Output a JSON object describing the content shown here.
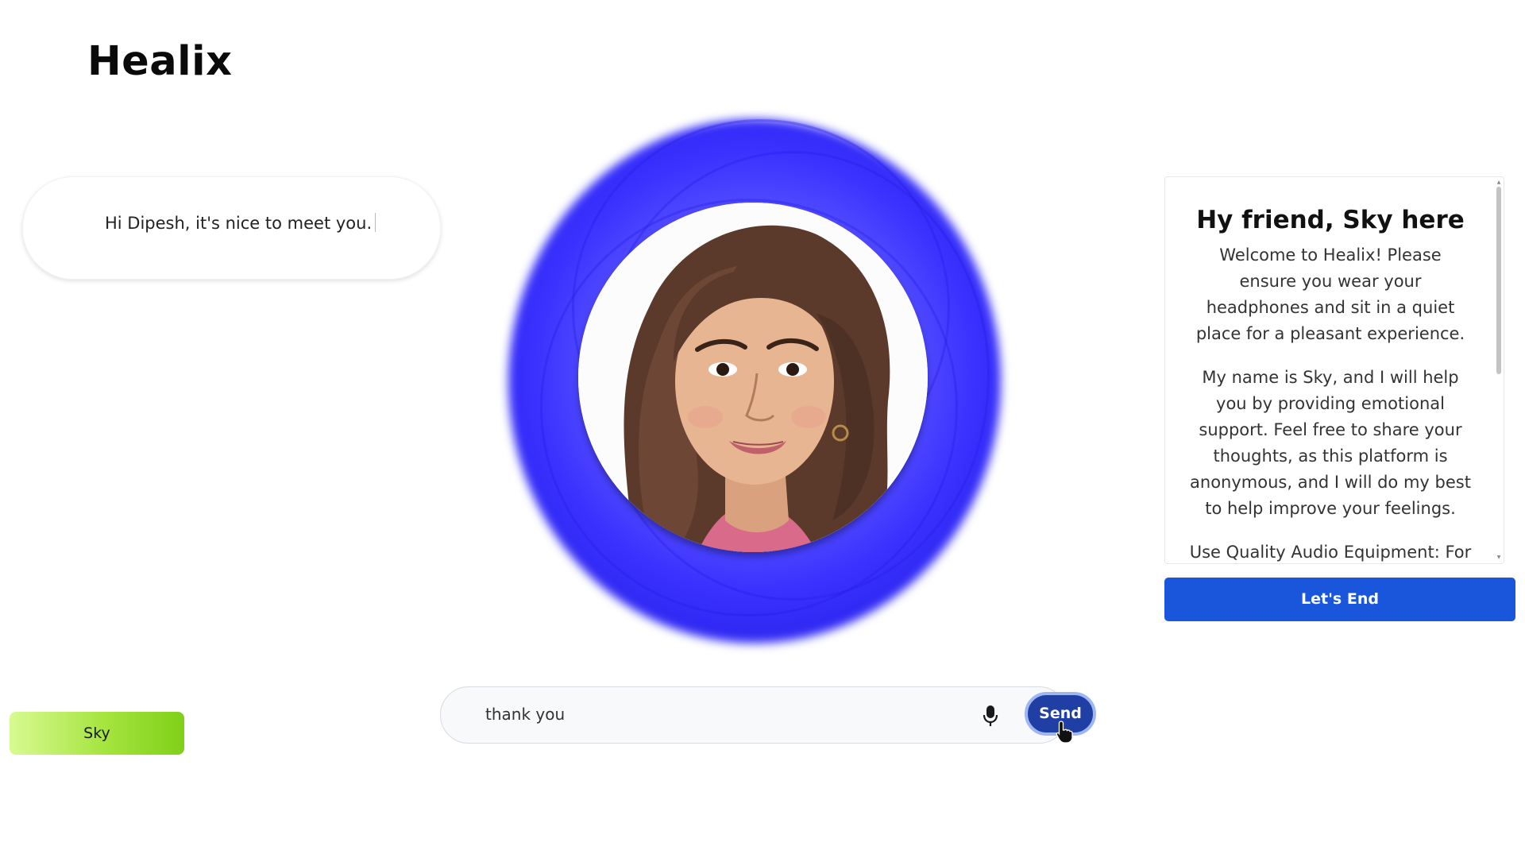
{
  "app": {
    "logo": "Healix"
  },
  "speech": {
    "text": "Hi Dipesh, it's nice to meet you."
  },
  "avatar": {
    "icon": "woman-portrait"
  },
  "chat": {
    "input_value": "thank you",
    "mic_icon": "microphone-icon",
    "send_label": "Send"
  },
  "persona": {
    "label": "Sky"
  },
  "info": {
    "title": "Hy friend, Sky here",
    "paragraphs": [
      "Welcome to Healix! Please ensure you wear your headphones and sit in a quiet place for a pleasant experience.",
      "My name is Sky, and I will help you by providing emotional support. Feel free to share your thoughts, as this platform is anonymous, and I will do my best to help improve your feelings.",
      "Use Quality Audio Equipment: For"
    ],
    "end_label": "Let's End"
  },
  "colors": {
    "halo": "#3a31ff",
    "send": "#1f3fa5",
    "end": "#1a56db",
    "sky_start": "#d8fa92",
    "sky_end": "#7fd018"
  }
}
